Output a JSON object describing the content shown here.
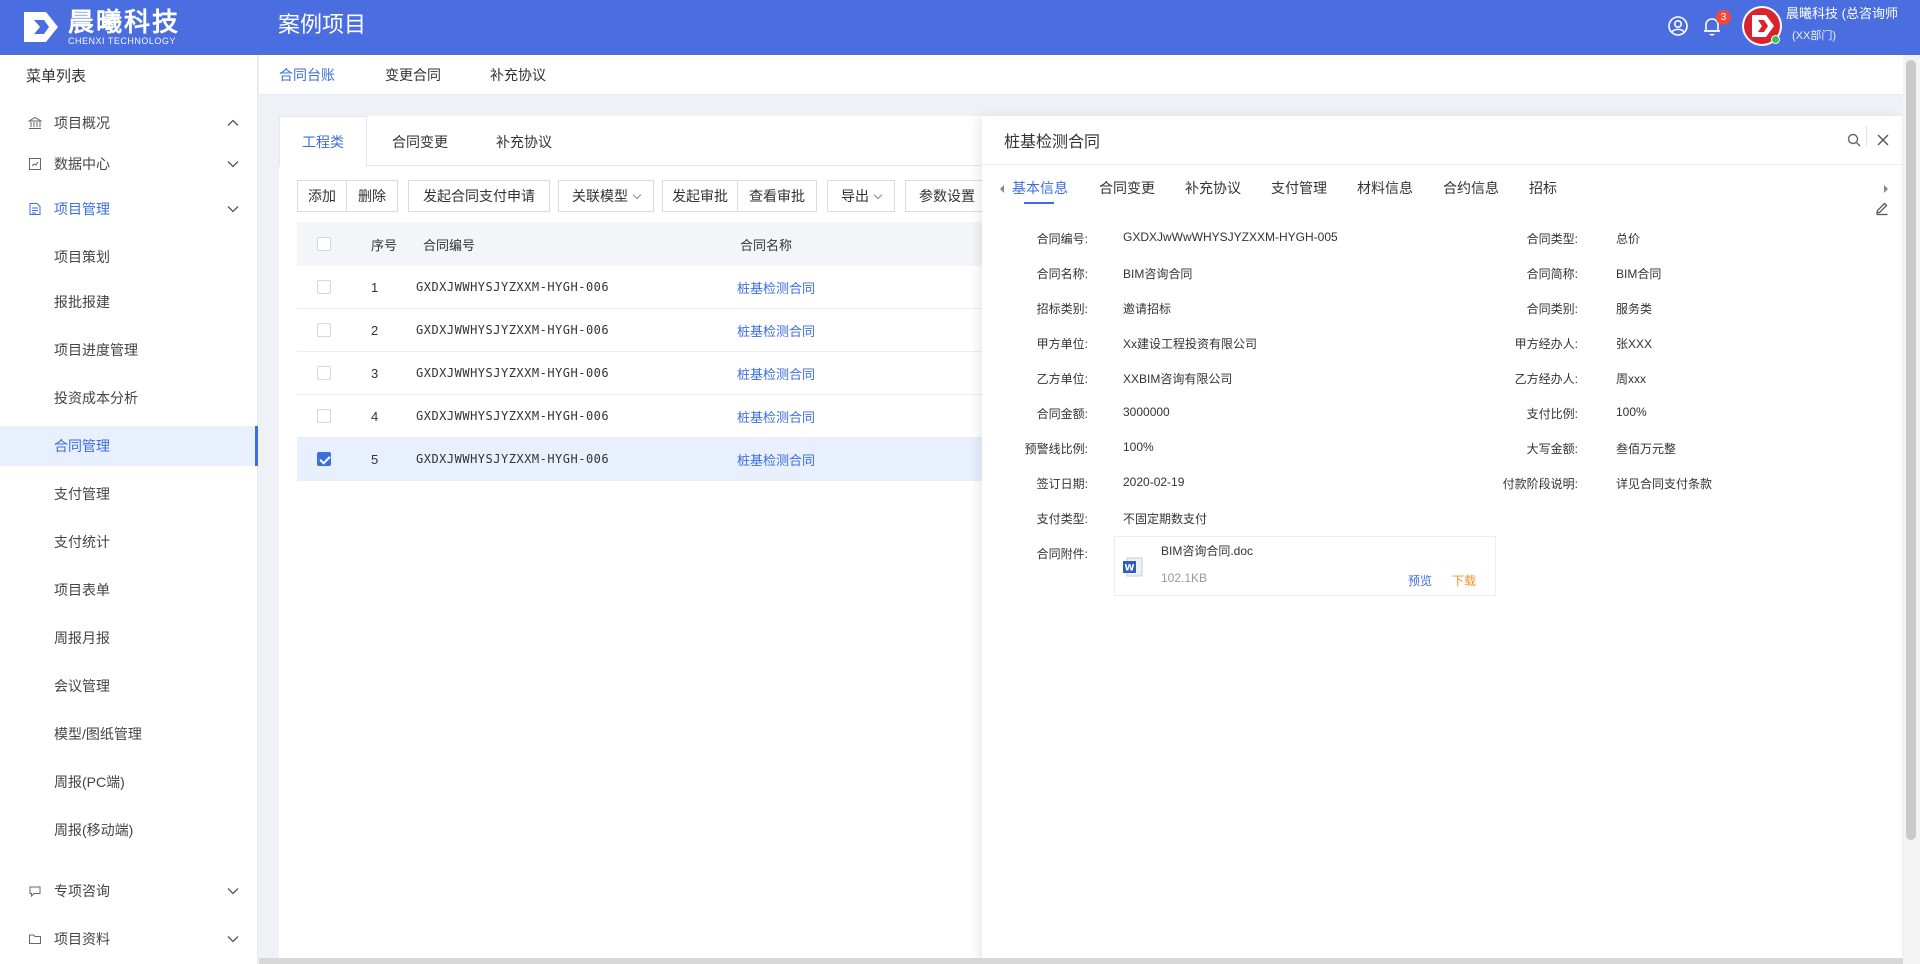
{
  "header": {
    "logo_cn": "晨曦科技",
    "logo_en": "CHENXI TECHNOLOGY",
    "app_title": "案例项目",
    "notification_count": "3",
    "user_name": "晨曦科技 (总咨询师",
    "user_dept": "(XX部门)"
  },
  "sidebar": {
    "title": "菜单列表",
    "groups": [
      {
        "label": "项目概况",
        "icon": "bank-icon",
        "expanded": true
      },
      {
        "label": "数据中心",
        "icon": "chart-box-icon",
        "expanded": false
      },
      {
        "label": "项目管理",
        "icon": "project-icon",
        "expanded": true
      }
    ],
    "sub_items": [
      "项目策划",
      "报批报建",
      "项目进度管理",
      "投资成本分析",
      "合同管理",
      "支付管理",
      "支付统计",
      "项目表单",
      "周报月报",
      "会议管理",
      "模型/图纸管理",
      "周报(PC端)",
      "周报(移动端)"
    ],
    "bottom_groups": [
      {
        "label": "专项咨询",
        "icon": "chat-icon"
      },
      {
        "label": "项目资料",
        "icon": "folder-icon"
      }
    ],
    "active_item": "合同管理"
  },
  "top_tabs": [
    "合同台账",
    "变更合同",
    "补充协议"
  ],
  "sub_tabs": [
    "工程类",
    "合同变更",
    "补充协议"
  ],
  "toolbar": {
    "add": "添加",
    "delete": "删除",
    "pay_request": "发起合同支付申请",
    "link_model": "关联模型",
    "start_approval": "发起审批",
    "view_approval": "查看审批",
    "export": "导出",
    "params": "参数设置"
  },
  "table": {
    "headers": {
      "index": "序号",
      "code": "合同编号",
      "name": "合同名称"
    },
    "rows": [
      {
        "index": "1",
        "code": "GXDXJWWHYSJYZXXM-HYGH-006",
        "name": "桩基检测合同",
        "checked": false
      },
      {
        "index": "2",
        "code": "GXDXJWWHYSJYZXXM-HYGH-006",
        "name": "桩基检测合同",
        "checked": false
      },
      {
        "index": "3",
        "code": "GXDXJWWHYSJYZXXM-HYGH-006",
        "name": "桩基检测合同",
        "checked": false
      },
      {
        "index": "4",
        "code": "GXDXJWWHYSJYZXXM-HYGH-006",
        "name": "桩基检测合同",
        "checked": false
      },
      {
        "index": "5",
        "code": "GXDXJWWHYSJYZXXM-HYGH-006",
        "name": "桩基检测合同",
        "checked": true
      }
    ]
  },
  "panel": {
    "title": "桩基检测合同",
    "tabs": [
      "基本信息",
      "合同变更",
      "补充协议",
      "支付管理",
      "材料信息",
      "合约信息",
      "招标"
    ],
    "left_fields": [
      {
        "label": "合同编号:",
        "value": "GXDXJwWwWHYSJYZXXM-HYGH-005"
      },
      {
        "label": "合同名称:",
        "value": "BIM咨询合同"
      },
      {
        "label": "招标类别:",
        "value": "邀请招标"
      },
      {
        "label": "甲方单位:",
        "value": "Xx建设工程投资有限公司"
      },
      {
        "label": "乙方单位:",
        "value": "XXBIM咨询有限公司"
      },
      {
        "label": "合同金额:",
        "value": "3000000"
      },
      {
        "label": "预警线比例:",
        "value": "100%"
      },
      {
        "label": "签订日期:",
        "value": "2020-02-19"
      },
      {
        "label": "支付类型:",
        "value": "不固定期数支付"
      },
      {
        "label": "合同附件:",
        "value": ""
      }
    ],
    "right_fields": [
      {
        "label": "合同类型:",
        "value": "总价"
      },
      {
        "label": "合同简称:",
        "value": "BIM合同"
      },
      {
        "label": "合同类别:",
        "value": "服务类"
      },
      {
        "label": "甲方经办人:",
        "value": "张XXX"
      },
      {
        "label": "乙方经办人:",
        "value": "周xxx"
      },
      {
        "label": "支付比例:",
        "value": "100%"
      },
      {
        "label": "大写金额:",
        "value": "叁佰万元整"
      },
      {
        "label": "付款阶段说明:",
        "value": "详见合同支付条款"
      }
    ],
    "attachment": {
      "name": "BIM咨询合同.doc",
      "size": "102.1KB",
      "preview": "预览",
      "download": "下载"
    }
  },
  "colors": {
    "primary": "#3c6ee0",
    "header_bg": "#4a6ee0",
    "download": "#f0902a"
  }
}
